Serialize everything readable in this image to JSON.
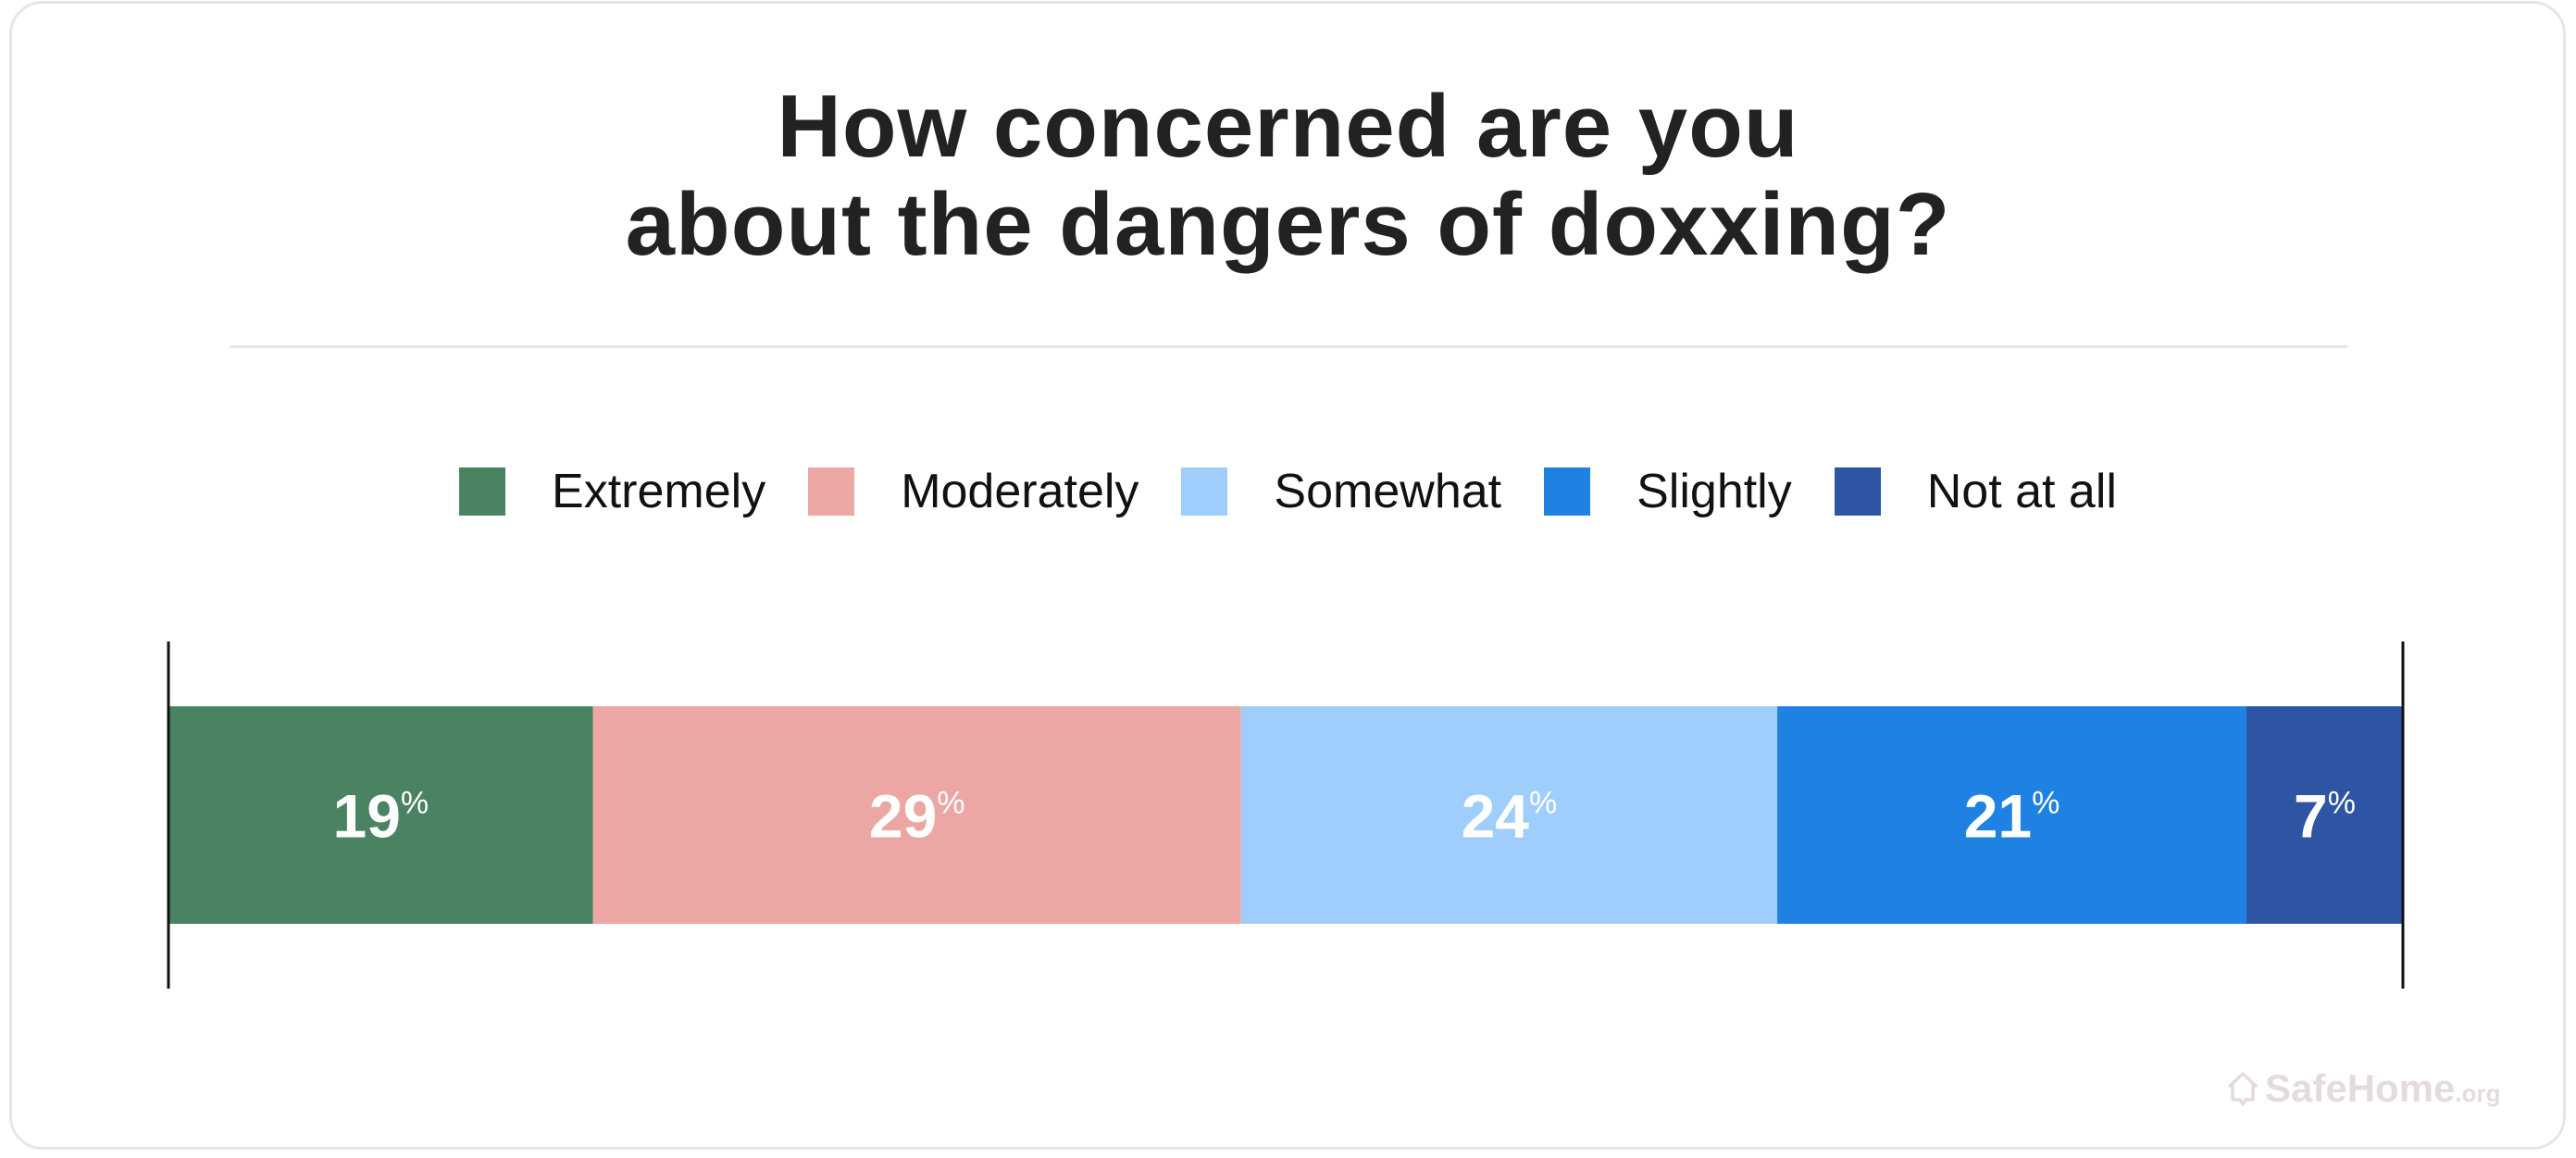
{
  "title_lines": [
    "How concerned are you",
    "about the dangers of doxxing?"
  ],
  "watermark": {
    "brand": "SafeHome",
    "suffix": ".org",
    "icon": "house-icon"
  },
  "chart_data": {
    "type": "bar",
    "orientation": "horizontal-stacked",
    "title": "How concerned are you about the dangers of doxxing?",
    "xlabel": "",
    "ylabel": "",
    "xlim": [
      0,
      100
    ],
    "grid": false,
    "legend_position": "top-center",
    "value_suffix": "%",
    "categories": [
      "Extremely",
      "Moderately",
      "Somewhat",
      "Slightly",
      "Not at all"
    ],
    "values": [
      19,
      29,
      24,
      21,
      7
    ],
    "colors": [
      "#4a8362",
      "#eca6a3",
      "#9fcdfc",
      "#1f81e2",
      "#2d55a3"
    ],
    "data_labels": [
      "19",
      "29",
      "24",
      "21",
      "7"
    ]
  }
}
